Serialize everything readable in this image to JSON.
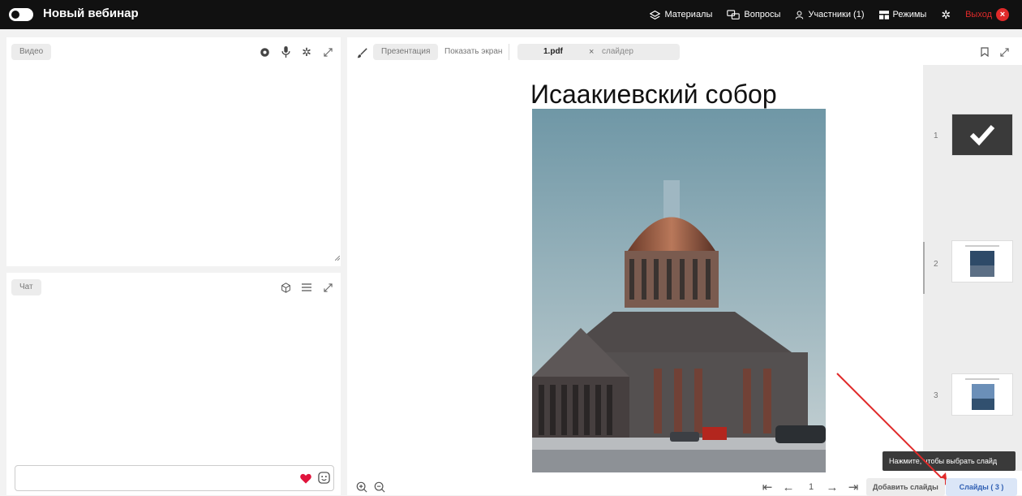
{
  "header": {
    "title": "Новый вебинар",
    "nav": {
      "materials": "Материалы",
      "questions": "Вопросы",
      "participants": "Участники (1)",
      "modes": "Режимы",
      "exit": "Выход"
    }
  },
  "video": {
    "label": "Видео"
  },
  "chat": {
    "label": "Чат"
  },
  "presentation": {
    "tabs": {
      "presentation": "Презентация",
      "share_screen": "Показать экран"
    },
    "file_name": "1.pdf",
    "slider_label": "слайдер",
    "slide_title": "Исаакиевский собор",
    "thumbnails": [
      "1",
      "2",
      "3"
    ],
    "page_number": "1",
    "add_slides": "Добавить слайды",
    "slides_count": "Слайды ( 3 )",
    "tooltip": "Нажмите, чтобы выбрать слайд"
  },
  "colors": {
    "topbar": "#111111",
    "exit": "#e02a2a",
    "heart": "#e0143c"
  }
}
